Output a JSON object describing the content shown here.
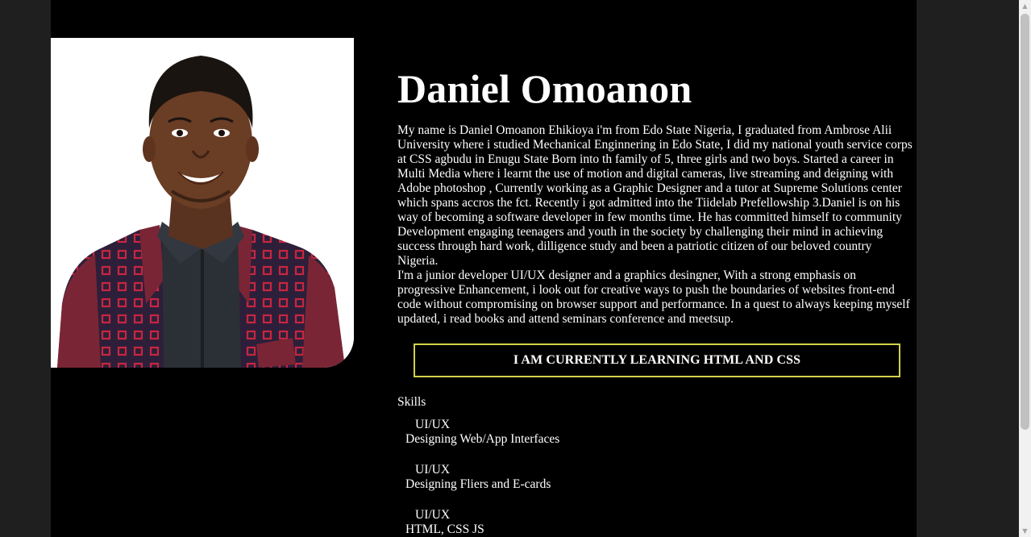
{
  "profile": {
    "name": "Daniel Omoanon",
    "bio_paragraphs": [
      "My name is Daniel Omoanon Ehikioya i'm from Edo State Nigeria, I graduated from Ambrose Alii University where i studied Mechanical Enginnering in Edo State, I did my national youth service corps at CSS agbudu in Enugu State Born into th family of 5, three girls and two boys. Started a career in Multi Media where i learnt the use of motion and digital cameras, live streaming and deigning with Adobe photoshop , Currently working as a Graphic Designer and a tutor at Supreme Solutions center which spans accros the fct. Recently i got admitted into the Tiidelab Prefellowship 3.Daniel is on his way of becoming a software developer in few months time. He has committed himself to community Development engaging teenagers and youth in the society by challenging their mind in achieving success through hard work, dilligence study and been a patriotic citizen of our beloved country Nigeria.",
      "I'm a junior developer UI/UX designer and a graphics desingner, With a strong emphasis on progressive Enhancement, i look out for creative ways to push the boundaries of websites front-end code without compromising on browser support and performance. In a quest to always keeping myself updated, i read books and attend seminars conference and meetsup."
    ],
    "learning_banner": "I AM CURRENTLY LEARNING HTML AND CSS",
    "skills_heading": "Skills",
    "skills": [
      {
        "title": "UI/UX",
        "description": "Designing Web/App Interfaces"
      },
      {
        "title": "UI/UX",
        "description": "Designing Fliers and E-cards"
      },
      {
        "title": "UI/UX",
        "description": "HTML, CSS JS"
      }
    ]
  },
  "colors": {
    "page_background": "#000000",
    "outer_background": "#1f1f1f",
    "text": "#ffffff",
    "banner_border": "#d2d24a"
  },
  "icons": {
    "scroll_up": "triangle-up",
    "scroll_down": "triangle-down"
  }
}
